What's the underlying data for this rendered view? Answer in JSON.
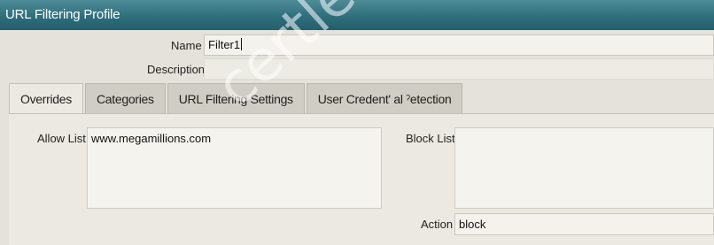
{
  "dialog": {
    "title": "URL Filtering Profile"
  },
  "form": {
    "name_label": "Name",
    "name_value": "Filter1",
    "description_label": "Description",
    "description_value": ""
  },
  "tabs": [
    {
      "label": "Overrides",
      "active": true
    },
    {
      "label": "Categories",
      "active": false
    },
    {
      "label": "URL Filtering Settings",
      "active": false
    },
    {
      "label": "User Credent' al  ˀetection",
      "active": false
    }
  ],
  "overrides": {
    "allow_list_label": "Allow List",
    "allow_list_value": "www.megamillions.com",
    "block_list_label": "Block List",
    "block_list_value": "",
    "action_label": "Action",
    "action_value": "block"
  },
  "watermark": "certleader.c"
}
